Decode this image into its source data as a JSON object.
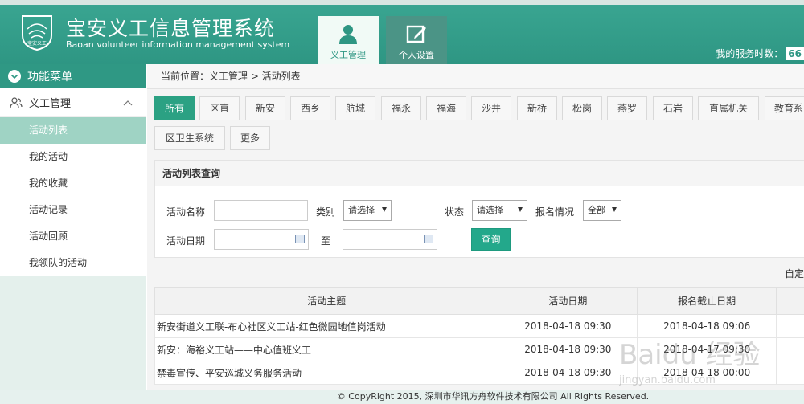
{
  "header": {
    "title": "宝安义工信息管理系统",
    "subtitle": "Baoan volunteer information management system",
    "logo_text": "宝安义工",
    "tabs": [
      {
        "label": "义工管理",
        "icon": "user-icon",
        "active": true
      },
      {
        "label": "个人设置",
        "icon": "edit-icon",
        "active": false
      }
    ],
    "service_label": "我的服务时数：",
    "service_value": "66"
  },
  "sidebar": {
    "menu_title": "功能菜单",
    "group_label": "义工管理",
    "items": [
      {
        "label": "活动列表",
        "active": true
      },
      {
        "label": "我的活动"
      },
      {
        "label": "我的收藏"
      },
      {
        "label": "活动记录"
      },
      {
        "label": "活动回顾"
      },
      {
        "label": "我领队的活动"
      }
    ]
  },
  "breadcrumb": "当前位置：义工管理 > 活动列表",
  "regions": [
    "所有",
    "区直",
    "新安",
    "西乡",
    "航城",
    "福永",
    "福海",
    "沙井",
    "新桥",
    "松岗",
    "燕罗",
    "石岩",
    "直属机关",
    "教育系",
    "区卫生系统",
    "更多"
  ],
  "query": {
    "title": "活动列表查询",
    "name_label": "活动名称",
    "category_label": "类别",
    "category_value": "请选择",
    "status_label": "状态",
    "status_value": "请选择",
    "signup_label": "报名情况",
    "signup_value": "全部",
    "date_label": "活动日期",
    "to_label": "至",
    "search_button": "查询"
  },
  "custom_label": "自定",
  "table": {
    "headers": [
      "活动主题",
      "活动日期",
      "报名截止日期"
    ],
    "rows": [
      [
        "新安街道义工联-布心社区义工站-红色微园地值岗活动",
        "2018-04-18 09:30",
        "2018-04-18 09:06"
      ],
      [
        "新安：海裕义工站——中心值班义工",
        "2018-04-18 09:30",
        "2018-04-17 09:30"
      ],
      [
        "禁毒宣传、平安巡城义务服务活动",
        "2018-04-18 09:30",
        "2018-04-18 00:00"
      ]
    ]
  },
  "footer": "© CopyRight 2015, 深圳市华讯方舟软件技术有限公司 All Rights Reserved.",
  "watermark": "Baidu 经验",
  "watermark_sub": "jingyan.baidu.com",
  "colors": {
    "brand": "#2e9683",
    "accent": "#2ba183",
    "sidebar_active": "#9fd3c4"
  }
}
